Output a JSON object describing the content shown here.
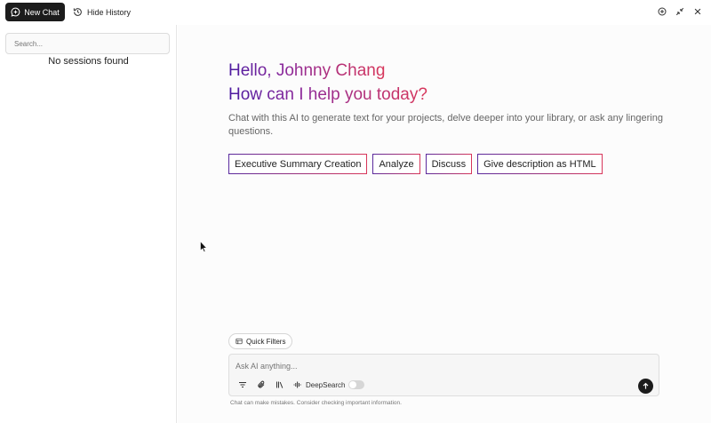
{
  "toolbar": {
    "new_chat_label": "New Chat",
    "hide_history_label": "Hide History",
    "icons": [
      "chat-plus-icon",
      "history-icon",
      "plus-circle-icon",
      "minimize-icon",
      "close-icon"
    ]
  },
  "sidebar": {
    "search_placeholder": "Search...",
    "empty_text": "No sessions found"
  },
  "main": {
    "greeting_line1": "Hello, Johnny Chang",
    "greeting_line2": "How can I help you today?",
    "subtitle": "Chat with this AI to generate text for your projects, delve deeper into your library, or ask any lingering questions.",
    "suggestions": [
      "Executive Summary Creation",
      "Analyze",
      "Discuss",
      "Give description as HTML"
    ],
    "quick_filters_label": "Quick Filters",
    "composer_placeholder": "Ask AI anything...",
    "deepsearch_label": "DeepSearch",
    "deepsearch_enabled": false,
    "disclaimer": "Chat can make mistakes. Consider checking important information."
  },
  "colors": {
    "accent_dark": "#1c1c1c",
    "gradient_start": "#4b1aa0",
    "gradient_end": "#d8365a"
  }
}
